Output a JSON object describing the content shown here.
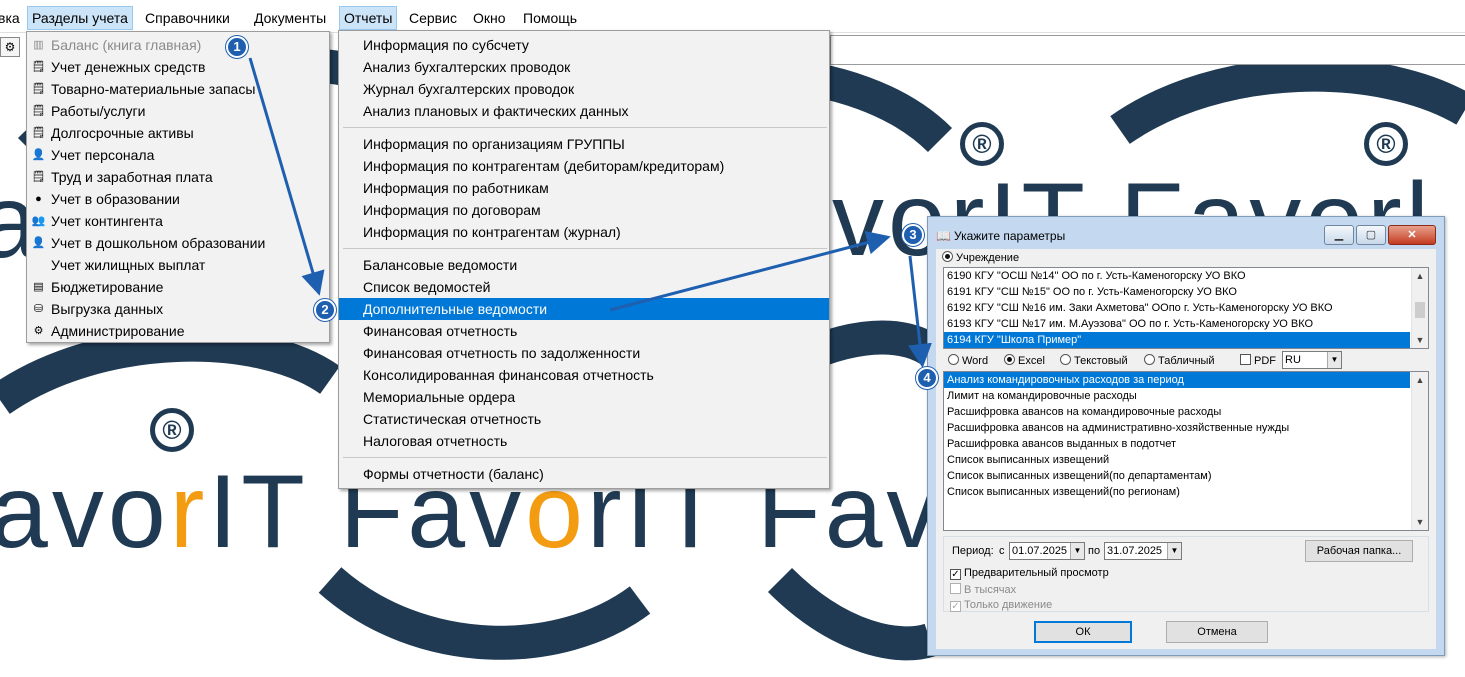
{
  "menubar": {
    "items": [
      "вка",
      "Разделы учета",
      "Справочники",
      "Документы",
      "Отчеты",
      "Сервис",
      "Окно",
      "Помощь"
    ],
    "active": [
      "Разделы учета",
      "Отчеты"
    ]
  },
  "watermark": {
    "mid_row_right": "vorIT Favorl",
    "bottom_row_dark_1": "avo",
    "bottom_row_orange_1": "r",
    "bottom_row_dark_2": "IT Fav",
    "bottom_row_orange_2": "o",
    "bottom_row_dark_3": "rIT Fav",
    "left_glyph": "a",
    "reg_symbol": "®",
    "brand_colors": {
      "dark": "#1f3a52",
      "orange": "#f39c12"
    }
  },
  "menu_sections": {
    "items": [
      {
        "label": "Баланс (книга главная)",
        "icon": "ledger-icon",
        "disabled": true
      },
      {
        "label": "Учет денежных средств",
        "icon": "cash-icon"
      },
      {
        "label": "Товарно-материальные запасы",
        "icon": "inventory-icon"
      },
      {
        "label": "Работы/услуги",
        "icon": "services-icon"
      },
      {
        "label": "Долгосрочные активы",
        "icon": "assets-icon"
      },
      {
        "label": "Учет персонала",
        "icon": "personnel-icon"
      },
      {
        "label": "Труд и заработная плата",
        "icon": "payroll-icon"
      },
      {
        "label": "Учет в образовании",
        "icon": "education-icon"
      },
      {
        "label": "Учет контингента",
        "icon": "contingent-icon"
      },
      {
        "label": "Учет в дошкольном образовании",
        "icon": "preschool-icon"
      },
      {
        "label": "Учет жилищных выплат",
        "icon": ""
      },
      {
        "label": "Бюджетирование",
        "icon": "budget-icon"
      },
      {
        "label": "Выгрузка данных",
        "icon": "export-icon"
      },
      {
        "label": "Администрирование",
        "icon": "admin-icon"
      }
    ]
  },
  "menu_reports": {
    "groups": [
      [
        "Информация по субсчету",
        "Анализ бухгалтерских проводок",
        "Журнал бухгалтерских проводок",
        "Анализ плановых и фактических данных"
      ],
      [
        "Информация по организациям ГРУППЫ",
        "Информация по контрагентам (дебиторам/кредиторам)",
        "Информация по работникам",
        "Информация по договорам",
        "Информация по контрагентам (журнал)"
      ],
      [
        "Балансовые ведомости",
        "Список ведомостей",
        "Дополнительные ведомости",
        "Финансовая отчетность",
        "Финансовая отчетность по задолженности",
        "Консолидированная финансовая отчетность",
        "Мемориальные ордера",
        "Статистическая отчетность",
        "Налоговая отчетность"
      ],
      [
        "Формы отчетности (баланс)"
      ]
    ],
    "selected": "Дополнительные ведомости"
  },
  "steps": [
    "1",
    "2",
    "3",
    "4"
  ],
  "dialog": {
    "title": "Укажите параметры",
    "org_label": "Учреждение",
    "orgs": [
      "6190 КГУ \"ОСШ №14\" ОО по г. Усть-Каменогорску УО ВКО",
      "6191 КГУ \"СШ №15\" ОО по г. Усть-Каменогорску УО ВКО",
      "6192 КГУ \"СШ №16 им. Заки Ахметова\" ООпо г. Усть-Каменогорску УО ВКО",
      "6193 КГУ \"СШ №17 им. М.Ауэзова\" ОО по г. Усть-Каменогорску УО ВКО",
      "6194 КГУ \"Школа Пример\""
    ],
    "org_selected_index": 4,
    "formats": [
      "Word",
      "Excel",
      "Текстовый",
      "Табличный"
    ],
    "format_selected": "Excel",
    "pdf_label": "PDF",
    "lang": "RU",
    "reports": [
      "Анализ командировочных расходов за период",
      "Лимит на командировочные расходы",
      "Расшифровка авансов на командировочные расходы",
      "Расшифровка авансов на административно-хозяйственные нужды",
      "Расшифровка авансов выданных в подотчет",
      "Список выписанных извещений",
      "Список выписанных извещений(по департаментам)",
      "Список выписанных извещений(по регионам)"
    ],
    "report_selected_index": 0,
    "period_label": "Период:",
    "from_label": "с",
    "date_from": "01.07.2025",
    "to_label": "по",
    "date_to": "31.07.2025",
    "work_folder": "Рабочая папка...",
    "preview_label": "Предварительный просмотр",
    "preview_checked": true,
    "thousands_label": "В тысячах",
    "movement_label": "Только движение",
    "ok": "ОК",
    "cancel": "Отмена"
  }
}
